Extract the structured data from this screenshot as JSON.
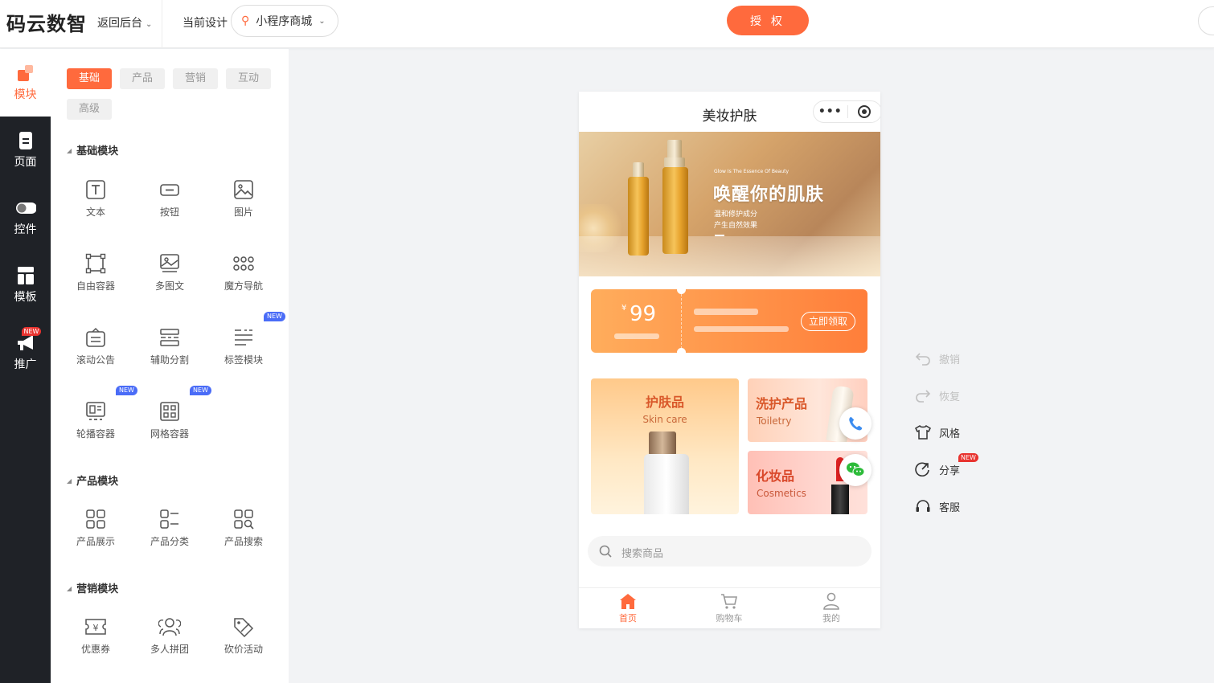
{
  "topbar": {
    "logo": "码云数智",
    "back_label": "返回后台",
    "current_design_label": "当前设计",
    "design_select_value": "小程序商城",
    "auth_button": "授 权"
  },
  "leftnav": {
    "items": [
      {
        "label": "模块",
        "icon": "blocks-icon"
      },
      {
        "label": "页面",
        "icon": "page-icon"
      },
      {
        "label": "控件",
        "icon": "toggle-icon"
      },
      {
        "label": "模板",
        "icon": "template-icon"
      },
      {
        "label": "推广",
        "icon": "megaphone-icon",
        "badge": "NEW"
      }
    ]
  },
  "panel": {
    "tabs": [
      "基础",
      "产品",
      "营销",
      "互动",
      "高级"
    ],
    "sections": [
      {
        "title": "基础模块",
        "modules": [
          "文本",
          "按钮",
          "图片",
          "自由容器",
          "多图文",
          "魔方导航",
          "滚动公告",
          "辅助分割",
          "标签模块",
          "轮播容器",
          "网格容器"
        ]
      },
      {
        "title": "产品模块",
        "modules": [
          "产品展示",
          "产品分类",
          "产品搜索"
        ]
      },
      {
        "title": "营销模块",
        "modules": [
          "优惠券",
          "多人拼团",
          "砍价活动"
        ]
      }
    ],
    "new_badge": "NEW"
  },
  "phone": {
    "title": "美妆护肤",
    "capsule_more": "•••",
    "banner": {
      "tagline_en": "Glow Is The Essence Of Beauty",
      "headline": "唤醒你的肌肤",
      "sub1": "温和修护成分",
      "sub2": "产生自然效果"
    },
    "coupon": {
      "currency": "¥",
      "amount": "99",
      "button": "立即领取"
    },
    "categories": [
      {
        "cn": "护肤品",
        "en": "Skin care"
      },
      {
        "cn": "洗护产品",
        "en": "Toiletry"
      },
      {
        "cn": "化妆品",
        "en": "Cosmetics"
      }
    ],
    "search_placeholder": "搜索商品",
    "tabbar": [
      {
        "label": "首页",
        "icon": "home-icon"
      },
      {
        "label": "购物车",
        "icon": "cart-icon"
      },
      {
        "label": "我的",
        "icon": "user-icon"
      }
    ]
  },
  "tools": {
    "undo": "撤销",
    "redo": "恢复",
    "style": "风格",
    "share": "分享",
    "share_badge": "NEW",
    "service": "客服"
  },
  "colors": {
    "accent": "#ff6a3d",
    "dark_nav": "#1f2227",
    "new_blue": "#4a6cf7",
    "new_red": "#e8332f"
  }
}
